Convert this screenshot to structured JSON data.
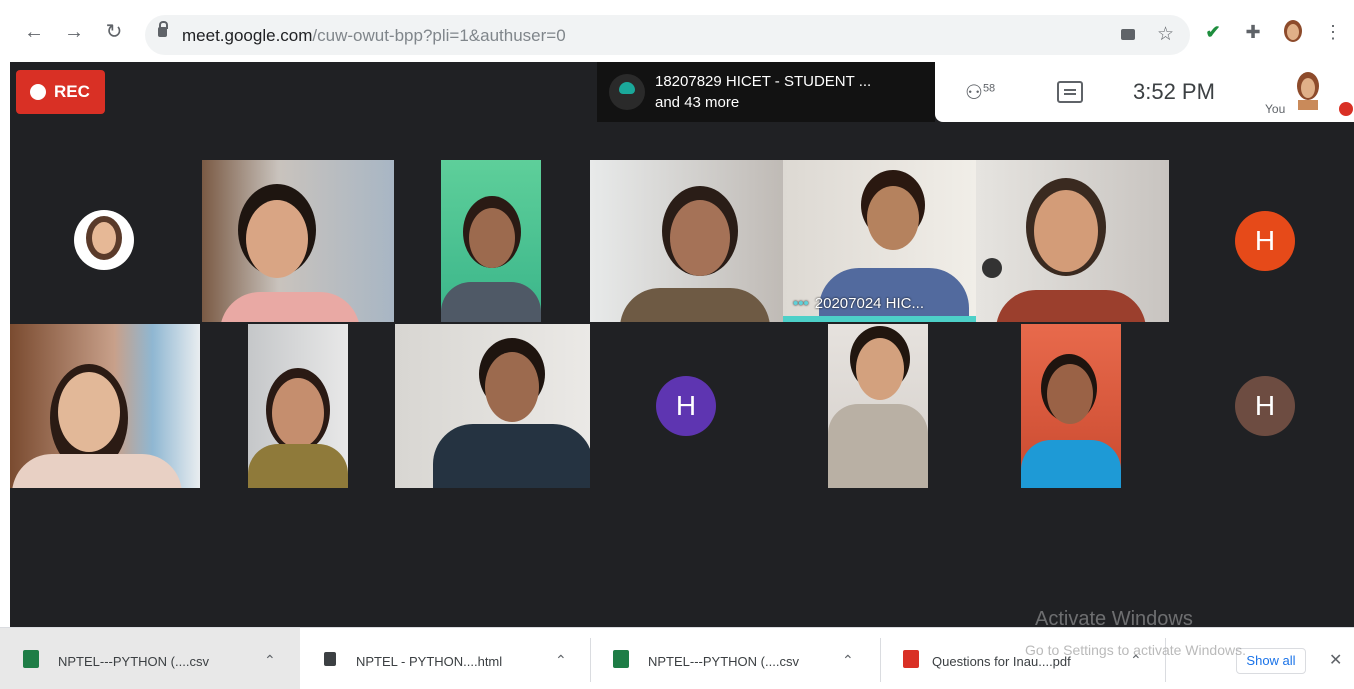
{
  "browser": {
    "url_host": "meet.google.com",
    "url_rest": "/cuw-owut-bpp?pli=1&authuser=0",
    "icons": [
      "back-arrow-icon",
      "forward-arrow-icon",
      "reload-icon",
      "lock-icon",
      "camera-icon",
      "star-icon",
      "checkmark-icon",
      "puzzle-icon",
      "profile-icon",
      "kebab-menu-icon"
    ]
  },
  "meet": {
    "rec_label": "REC",
    "presenter_line1": "18207829 HICET - STUDENT ...",
    "presenter_line2": "and 43 more",
    "participants_count": "58",
    "clock": "3:52 PM",
    "you_label": "You",
    "tile_name": "20207024 HIC...",
    "tile_dots": "•••",
    "avatar_letter": "H",
    "avatar_colors": [
      "#e8710a",
      "#5e35b1",
      "#6d4c41"
    ]
  },
  "downloads": {
    "items": [
      {
        "name": "NPTEL---PYTHON (....csv",
        "type": "excel-icon"
      },
      {
        "name": "NPTEL - PYTHON....html",
        "type": "html-icon"
      },
      {
        "name": "NPTEL---PYTHON (....csv",
        "type": "excel-icon"
      },
      {
        "name": "Questions for Inau....pdf",
        "type": "pdf-icon"
      }
    ],
    "show_all": "Show all",
    "close": "✕"
  },
  "watermark": {
    "line1": "Activate Windows",
    "line2": "Go to Settings to activate Windows."
  }
}
